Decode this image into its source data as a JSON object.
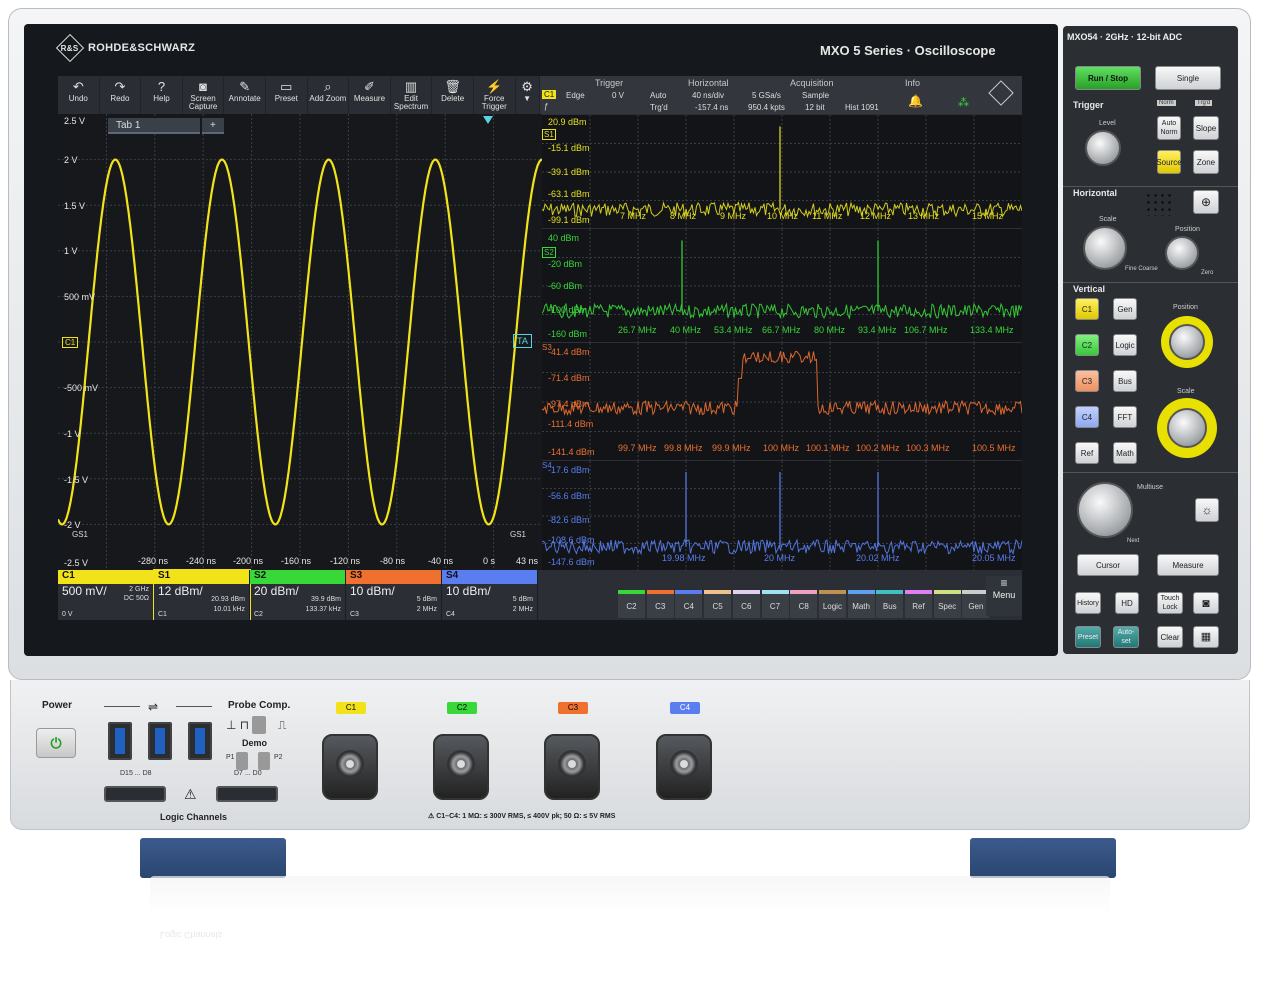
{
  "brand": {
    "name": "ROHDE&SCHWARZ",
    "series": "MXO 5 Series · Oscilloscope",
    "model": "MXO54 · 2GHz · 12-bit ADC"
  },
  "toolbar": {
    "items": [
      {
        "label": "Undo",
        "icon": "↶"
      },
      {
        "label": "Redo",
        "icon": "↷"
      },
      {
        "label": "Help",
        "icon": "?"
      },
      {
        "label": "Screen Capture",
        "icon": "◙"
      },
      {
        "label": "Annotate",
        "icon": "✎"
      },
      {
        "label": "Preset",
        "icon": "▭"
      },
      {
        "label": "Add Zoom",
        "icon": "⌕"
      },
      {
        "label": "Measure",
        "icon": "✐"
      },
      {
        "label": "Edit Spectrum",
        "icon": "▥"
      },
      {
        "label": "Delete",
        "icon": "🗑"
      },
      {
        "label": "Force Trigger",
        "icon": "⚡"
      }
    ]
  },
  "info": {
    "trigger": {
      "title": "Trigger",
      "source": "C1",
      "type": "Edge",
      "level": "0 V",
      "mode": "Auto",
      "state": "Trg'd"
    },
    "horizontal": {
      "title": "Horizontal",
      "scale": "40 ns/div",
      "position": "-157.4 ns"
    },
    "acquisition": {
      "title": "Acquisition",
      "rate": "5 GSa/s",
      "mode": "Sample",
      "points": "950.4 kpts",
      "bits": "12 bit",
      "hist": "Hist 1091"
    },
    "info_title": "Info"
  },
  "tabs": {
    "tab1": "Tab 1",
    "add": "+"
  },
  "time_plot": {
    "y_labels": [
      "2.5 V",
      "2 V",
      "1.5 V",
      "1 V",
      "500 mV",
      "-500 mV",
      "-1 V",
      "-1.5 V",
      "-2 V",
      "-2.5 V"
    ],
    "x_labels": [
      "-280 ns",
      "-240 ns",
      "-200 ns",
      "-160 ns",
      "-120 ns",
      "-80 ns",
      "-40 ns",
      "0 s",
      "43 ns"
    ],
    "marker_c1": "C1",
    "marker_ta": "TA",
    "gs1_left": "GS1",
    "gs1_right": "GS1",
    "color": "#f2e21a"
  },
  "chart_data": {
    "type": "line",
    "series": [
      {
        "name": "C1",
        "shape": "sine",
        "amplitude_v": 2.0,
        "period_ns": 80
      }
    ],
    "x_range_ns": [
      -320,
      43
    ],
    "y_range_v": [
      -2.5,
      2.5
    ]
  },
  "spectra": [
    {
      "id": "S1",
      "color": "#e8e020",
      "levels": [
        "20.9 dBm",
        "-15.1 dBm",
        "-39.1 dBm",
        "-63.1 dBm",
        "-99.1 dBm"
      ],
      "freqs": [
        "7 MHz",
        "8 MHz",
        "9 MHz",
        "10 MHz",
        "11 MHz",
        "12 MHz",
        "13 MHz",
        "15 MHz"
      ]
    },
    {
      "id": "S2",
      "color": "#38d838",
      "levels": [
        "40 dBm",
        "-20 dBm",
        "-60 dBm",
        "-100 dBm",
        "-160 dBm"
      ],
      "freqs": [
        "26.7 MHz",
        "40 MHz",
        "53.4 MHz",
        "66.7 MHz",
        "80 MHz",
        "93.4 MHz",
        "106.7 MHz",
        "133.4 MHz"
      ]
    },
    {
      "id": "S3",
      "color": "#f07030",
      "levels": [
        "-41.4 dBm",
        "-71.4 dBm",
        "-97.4 dBm",
        "-111.4 dBm",
        "-141.4 dBm"
      ],
      "freqs": [
        "99.7 MHz",
        "99.8 MHz",
        "99.9 MHz",
        "100 MHz",
        "100.1 MHz",
        "100.2 MHz",
        "100.3 MHz",
        "100.5 MHz"
      ]
    },
    {
      "id": "S4",
      "color": "#5a7ef0",
      "levels": [
        "-17.6 dBm",
        "-56.6 dBm",
        "-82.6 dBm",
        "-108.6 dBm",
        "-147.6 dBm"
      ],
      "freqs": [
        "19.98 MHz",
        "20 MHz",
        "20.02 MHz",
        "20.05 MHz"
      ]
    }
  ],
  "channels": [
    {
      "name": "C1",
      "color": "#f2e21a",
      "value": "500 mV/",
      "sub1": "2 GHz",
      "sub2": "DC 50Ω",
      "foot": "0 V"
    },
    {
      "name": "S1",
      "color": "#f2e21a",
      "value": "12 dBm/",
      "sub1": "20.93 dBm",
      "sub2": "10.01 kHz",
      "foot": "C1"
    },
    {
      "name": "S2",
      "color": "#38d838",
      "value": "20 dBm/",
      "sub1": "39.9 dBm",
      "sub2": "133.37 kHz",
      "foot": "C2"
    },
    {
      "name": "S3",
      "color": "#f07030",
      "value": "10 dBm/",
      "sub1": "5 dBm",
      "sub2": "2 MHz",
      "foot": "C3"
    },
    {
      "name": "S4",
      "color": "#5a7ef0",
      "value": "10 dBm/",
      "sub1": "5 dBm",
      "sub2": "2 MHz",
      "foot": "C4"
    }
  ],
  "source_buttons": [
    {
      "label": "C2",
      "color": "#38d838"
    },
    {
      "label": "C3",
      "color": "#f07030"
    },
    {
      "label": "C4",
      "color": "#5a7ef0"
    },
    {
      "label": "C5",
      "color": "#f0c090"
    },
    {
      "label": "C6",
      "color": "#e0d0f0"
    },
    {
      "label": "C7",
      "color": "#a0e0f0"
    },
    {
      "label": "C8",
      "color": "#f0a0c0"
    },
    {
      "label": "Logic",
      "color": "#c09050"
    },
    {
      "label": "Math",
      "color": "#60a0f0"
    },
    {
      "label": "Bus",
      "color": "#40c0c0"
    },
    {
      "label": "Ref",
      "color": "#e080f0"
    },
    {
      "label": "Spec",
      "color": "#d0e080"
    },
    {
      "label": "Gen",
      "color": "#cccccc"
    }
  ],
  "menu_label": "Menu",
  "side": {
    "run_stop": "Run / Stop",
    "single": "Single",
    "trigger_title": "Trigger",
    "norm": "Norm",
    "trgd": "Trg'd",
    "level": "Level",
    "auto_norm": "Auto Norm",
    "slope": "Slope",
    "source": "Source",
    "zone": "Zone",
    "horizontal_title": "Horizontal",
    "scale": "Scale",
    "position": "Position",
    "fine_coarse": "Fine Coarse",
    "zero": "Zero",
    "vertical_title": "Vertical",
    "c1": "C1",
    "gen": "Gen",
    "c2": "C2",
    "logic": "Logic",
    "c3": "C3",
    "bus": "Bus",
    "c4": "C4",
    "fft": "FFT",
    "ref": "Ref",
    "math": "Math",
    "multiuse": "Multiuse",
    "next": "Next",
    "cursor": "Cursor",
    "measure": "Measure",
    "history": "History",
    "hd": "HD",
    "touch_lock": "Touch Lock",
    "preset": "Preset",
    "autoset": "Auto-set",
    "clear": "Clear"
  },
  "front": {
    "power": "Power",
    "probe_comp": "Probe Comp.",
    "demo": "Demo",
    "p1": "P1",
    "p2": "P2",
    "d15_d8": "D15 ... D8",
    "d7_d0": "D7 ... D0",
    "logic_channels": "Logic Channels",
    "warning": "C1–C4: 1 MΩ: ≤ 300V RMS, ≤ 400V pk; 50 Ω: ≤ 5V RMS",
    "inputs": [
      "C1",
      "C2",
      "C3",
      "C4"
    ],
    "input_colors": [
      "#f2e21a",
      "#38d838",
      "#f07030",
      "#5a7ef0"
    ]
  }
}
